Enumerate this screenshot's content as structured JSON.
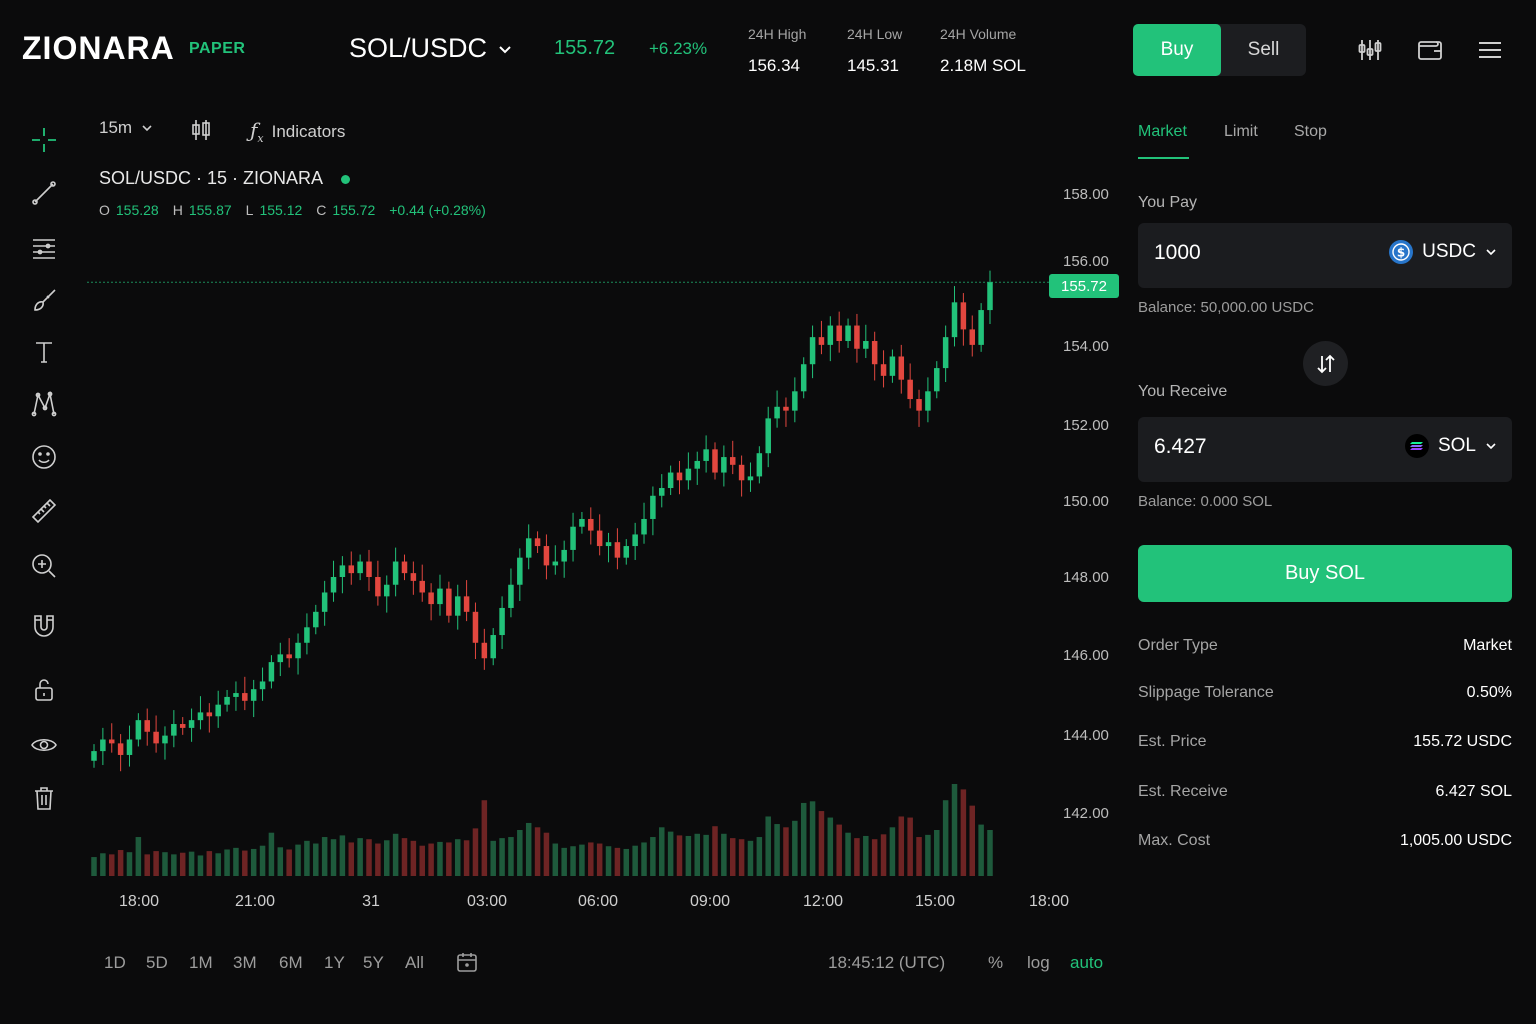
{
  "header": {
    "brand": "ZIONARA",
    "mode_badge": "PAPER",
    "pair": "SOL/USDC",
    "last_price": "155.72",
    "change_pct": "+6.23%",
    "stats": [
      {
        "label": "24H High",
        "value": "156.34"
      },
      {
        "label": "24H Low",
        "value": "145.31"
      },
      {
        "label": "24H Volume",
        "value": "2.18M SOL"
      }
    ],
    "buy_label": "Buy",
    "sell_label": "Sell",
    "icons": [
      "chart-settings-icon",
      "wallet-icon",
      "menu-icon"
    ]
  },
  "toolbar": {
    "interval": "15m",
    "indicators_label": "Indicators",
    "tools": [
      "crosshair-icon",
      "trendline-icon",
      "fib-icon",
      "brush-icon",
      "text-icon",
      "pattern-icon",
      "emoji-icon",
      "ruler-icon",
      "zoom-in-icon",
      "magnet-icon",
      "lock-icon",
      "eye-icon",
      "trash-icon"
    ]
  },
  "legend": {
    "title": "SOL/USDC · 15 · ZIONARA",
    "o_label": "O",
    "o": "155.28",
    "h_label": "H",
    "h": "155.87",
    "l_label": "L",
    "l": "155.12",
    "c_label": "C",
    "c": "155.72",
    "change": "+0.44 (+0.28%)"
  },
  "chart_data": {
    "type": "candlestick",
    "y_ticks": [
      "158.00",
      "156.00",
      "154.00",
      "152.00",
      "150.00",
      "148.00",
      "146.00",
      "144.00",
      "142.00"
    ],
    "x_ticks": [
      "18:00",
      "21:00",
      "31",
      "03:00",
      "06:00",
      "09:00",
      "12:00",
      "15:00",
      "18:00"
    ],
    "last_price_tag": "155.72",
    "ylim": [
      141.2,
      158.5
    ],
    "up_color": "#22c27a",
    "down_color": "#e2473f",
    "close": [
      143.6,
      143.9,
      143.8,
      143.5,
      143.9,
      144.4,
      144.1,
      143.8,
      144.0,
      144.3,
      144.2,
      144.4,
      144.6,
      144.5,
      144.8,
      145.0,
      145.1,
      144.9,
      145.2,
      145.4,
      145.9,
      146.1,
      146.0,
      146.4,
      146.8,
      147.2,
      147.7,
      148.1,
      148.4,
      148.2,
      148.5,
      148.1,
      147.6,
      147.9,
      148.5,
      148.2,
      148.0,
      147.7,
      147.4,
      147.8,
      147.1,
      147.6,
      147.2,
      146.4,
      146.0,
      146.6,
      147.3,
      147.9,
      148.6,
      149.1,
      148.9,
      148.4,
      148.5,
      148.8,
      149.4,
      149.6,
      149.3,
      148.9,
      149.0,
      148.6,
      148.9,
      149.2,
      149.6,
      150.2,
      150.4,
      150.8,
      150.6,
      150.9,
      151.1,
      151.4,
      150.8,
      151.2,
      151.0,
      150.6,
      150.7,
      151.3,
      152.2,
      152.5,
      152.4,
      152.9,
      153.6,
      154.3,
      154.1,
      154.6,
      154.2,
      154.6,
      154.0,
      154.2,
      153.6,
      153.3,
      153.8,
      153.2,
      152.7,
      152.4,
      152.9,
      153.5,
      154.3,
      155.2,
      154.5,
      154.1,
      155.0,
      155.72
    ],
    "volume": [
      35,
      42,
      40,
      48,
      44,
      72,
      40,
      46,
      44,
      40,
      43,
      45,
      38,
      46,
      42,
      49,
      52,
      47,
      50,
      56,
      80,
      53,
      49,
      58,
      65,
      60,
      72,
      68,
      75,
      62,
      70,
      68,
      60,
      66,
      78,
      70,
      65,
      56,
      60,
      63,
      62,
      68,
      66,
      88,
      140,
      65,
      70,
      72,
      85,
      98,
      90,
      80,
      60,
      52,
      55,
      58,
      62,
      60,
      55,
      52,
      50,
      56,
      62,
      72,
      90,
      82,
      75,
      74,
      78,
      76,
      92,
      78,
      70,
      68,
      65,
      72,
      110,
      96,
      90,
      102,
      135,
      138,
      120,
      108,
      95,
      80,
      70,
      74,
      68,
      77,
      90,
      110,
      108,
      72,
      76,
      85,
      140,
      170,
      160,
      130,
      95,
      85
    ]
  },
  "footer": {
    "ranges": [
      "1D",
      "5D",
      "1M",
      "3M",
      "6M",
      "1Y",
      "5Y",
      "All"
    ],
    "clock": "18:45:12 (UTC)",
    "pct_label": "%",
    "log_label": "log",
    "auto_label": "auto"
  },
  "order": {
    "tabs": [
      "Market",
      "Limit",
      "Stop"
    ],
    "active_tab": "Market",
    "pay_label": "You Pay",
    "pay_value": "1000",
    "pay_token": "USDC",
    "pay_balance": "Balance: 50,000.00 USDC",
    "receive_label": "You Receive",
    "receive_value": "6.427",
    "receive_token": "SOL",
    "receive_balance": "Balance: 0.000 SOL",
    "cta": "Buy SOL",
    "details": [
      {
        "k": "Order Type",
        "v": "Market"
      },
      {
        "k": "Slippage Tolerance",
        "v": "0.50%"
      },
      {
        "k": "Est. Price",
        "v": "155.72 USDC"
      },
      {
        "k": "Est. Receive",
        "v": "6.427 SOL"
      },
      {
        "k": "Max. Cost",
        "v": "1,005.00 USDC"
      }
    ]
  }
}
